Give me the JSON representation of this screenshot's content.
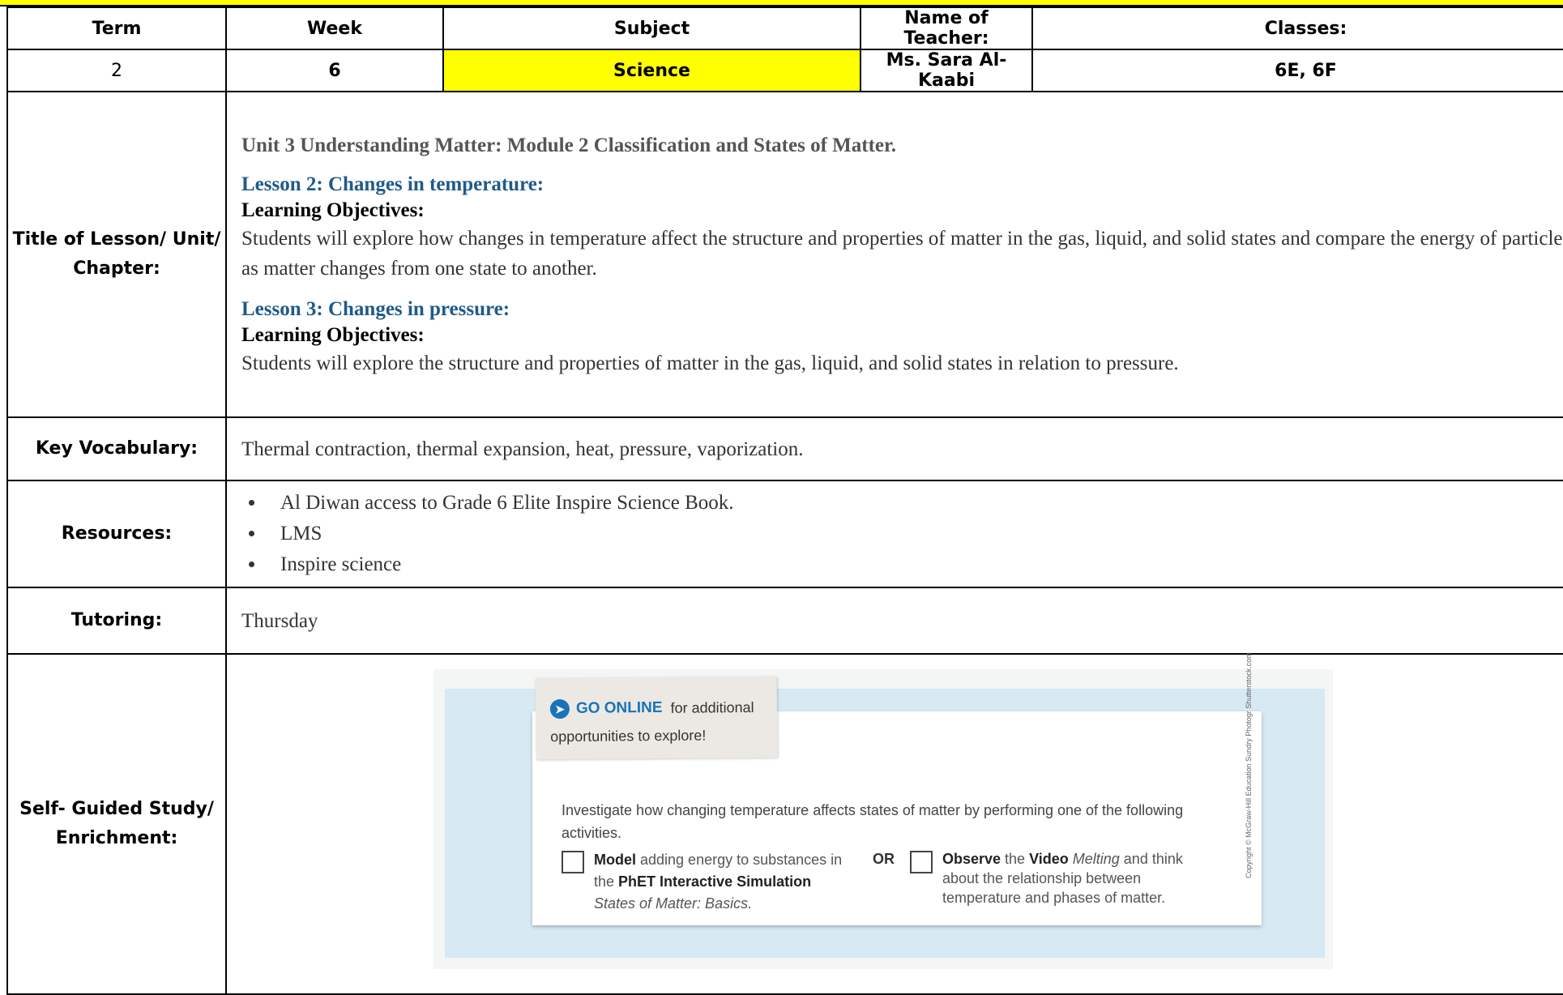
{
  "header": {
    "term_label": "Term",
    "week_label": "Week",
    "subject_label": "Subject",
    "teacher_label": "Name of Teacher:",
    "classes_label": "Classes:",
    "term_value": "2",
    "week_value": "6",
    "subject_value": "Science",
    "teacher_value": "Ms. Sara Al-Kaabi",
    "classes_value": "6E, 6F"
  },
  "title_row": {
    "label": "Title of Lesson/ Unit/ Chapter:",
    "unit": "Unit 3 Understanding Matter: Module 2 Classification and States of Matter.",
    "lesson2_title": "Lesson 2: Changes in temperature:",
    "lesson2_obj_label": "Learning Objectives:",
    "lesson2_obj": "Students will explore how changes in temperature affect the structure and properties of matter in the gas, liquid, and solid states and compare the energy of particles as matter changes from one state to another.",
    "lesson3_title": "Lesson 3: Changes in pressure:",
    "lesson3_obj_label": "Learning Objectives:",
    "lesson3_obj": "Students will explore the structure and properties of matter in the gas, liquid, and solid states in relation to pressure."
  },
  "vocab_row": {
    "label": "Key Vocabulary:",
    "value": "Thermal contraction, thermal expansion, heat, pressure, vaporization."
  },
  "resources_row": {
    "label": "Resources:",
    "items": [
      "Al Diwan access to Grade 6 Elite Inspire Science Book.",
      "LMS",
      "Inspire science"
    ]
  },
  "tutoring_row": {
    "label": "Tutoring:",
    "value": "Thursday"
  },
  "enrichment_row": {
    "label": "Self- Guided Study/ Enrichment:",
    "image": {
      "go_online": "GO ONLINE",
      "go_rest": "for additional",
      "go_line2": "opportunities to explore!",
      "instruction": "Investigate how changing temperature affects states of matter by performing one of the following activities.",
      "left_bold1": "Model",
      "left_text1": " adding energy to substances in the ",
      "left_bold2": "PhET Interactive Simulation",
      "left_italic": " States of Matter: Basics.",
      "or": "OR",
      "right_bold1": "Observe",
      "right_text1": " the ",
      "right_bold2": "Video",
      "right_italic": " Melting",
      "right_text2": " and think about the relationship between temperature and phases of matter.",
      "side_credit": "Copyright © McGraw-Hill Education  Sundry Photogr Shutterstock.com"
    }
  }
}
